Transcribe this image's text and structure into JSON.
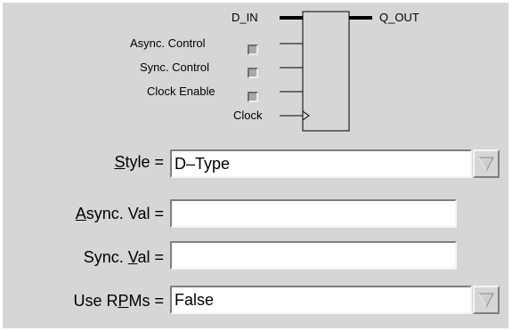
{
  "diagram": {
    "input_label": "D_IN",
    "output_label": "Q_OUT",
    "controls": [
      {
        "label": "Async. Control",
        "checked": false
      },
      {
        "label": "Sync. Control",
        "checked": false
      },
      {
        "label": "Clock Enable",
        "checked": false
      }
    ],
    "clock_label": "Clock"
  },
  "form": {
    "style": {
      "pre": "",
      "mnemonic": "S",
      "post": "tyle =",
      "value": "D–Type"
    },
    "async_val": {
      "pre": "",
      "mnemonic": "A",
      "post": "sync. Val =",
      "value": ""
    },
    "sync_val": {
      "pre": "Sync. ",
      "mnemonic": "V",
      "post": "al =",
      "value": ""
    },
    "use_rpms": {
      "pre": "Use R",
      "mnemonic": "P",
      "post": "Ms =",
      "value": "False"
    }
  },
  "colors": {
    "panel": "#d6d6d6",
    "field": "#ffffff",
    "checkbox": "#a9a9a9"
  },
  "icons": {
    "dropdown": "triangle-down-icon"
  }
}
